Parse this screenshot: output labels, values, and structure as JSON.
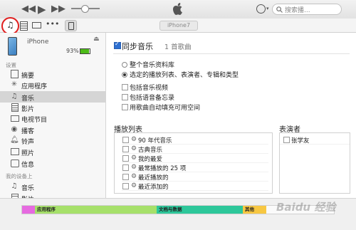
{
  "titlebar": {
    "search_placeholder": "搜索播...",
    "device_badge": "iPhone7"
  },
  "device": {
    "name": "iPhone",
    "battery_pct": "93%",
    "battery_level": 0.93
  },
  "sidebar": {
    "settings_header": "设置",
    "items": [
      {
        "label": "摘要",
        "icon": "summary-icon"
      },
      {
        "label": "应用程序",
        "icon": "apps-icon"
      },
      {
        "label": "音乐",
        "icon": "music-note-icon"
      },
      {
        "label": "影片",
        "icon": "film-icon"
      },
      {
        "label": "电视节目",
        "icon": "tv-icon"
      },
      {
        "label": "播客",
        "icon": "podcast-icon"
      },
      {
        "label": "铃声",
        "icon": "bell-icon"
      },
      {
        "label": "照片",
        "icon": "photo-icon"
      },
      {
        "label": "信息",
        "icon": "info-icon"
      }
    ],
    "mydevice_header": "我的设备上",
    "mydevice_items": [
      {
        "label": "音乐",
        "icon": "music-note-icon"
      },
      {
        "label": "影片",
        "icon": "film-icon"
      }
    ]
  },
  "main": {
    "sync_label": "同步音乐",
    "sync_count": "1 首歌曲",
    "radio_all": "整个音乐资料库",
    "radio_selected": "选定的播放列表、表演者、专辑和类型",
    "opt_videos": "包括音乐视频",
    "opt_voice": "包括语音备忘录",
    "opt_fill": "用歌曲自动填充可用空间",
    "playlists_title": "播放列表",
    "playlists": [
      "90 年代音乐",
      "古典音乐",
      "我的最爱",
      "最常播放的 25 项",
      "最近播放的",
      "最近添加的"
    ],
    "artists_title": "表演者",
    "artists": [
      "张学友"
    ]
  },
  "storage": {
    "segments": [
      {
        "label": "",
        "color": "#e66ae0"
      },
      {
        "label": "应用程序",
        "color": "#a6e06a"
      },
      {
        "label": "文档与数据",
        "color": "#2dc79a"
      },
      {
        "label": "其他",
        "color": "#f7c742"
      }
    ]
  },
  "watermark": "Baidu 经验"
}
